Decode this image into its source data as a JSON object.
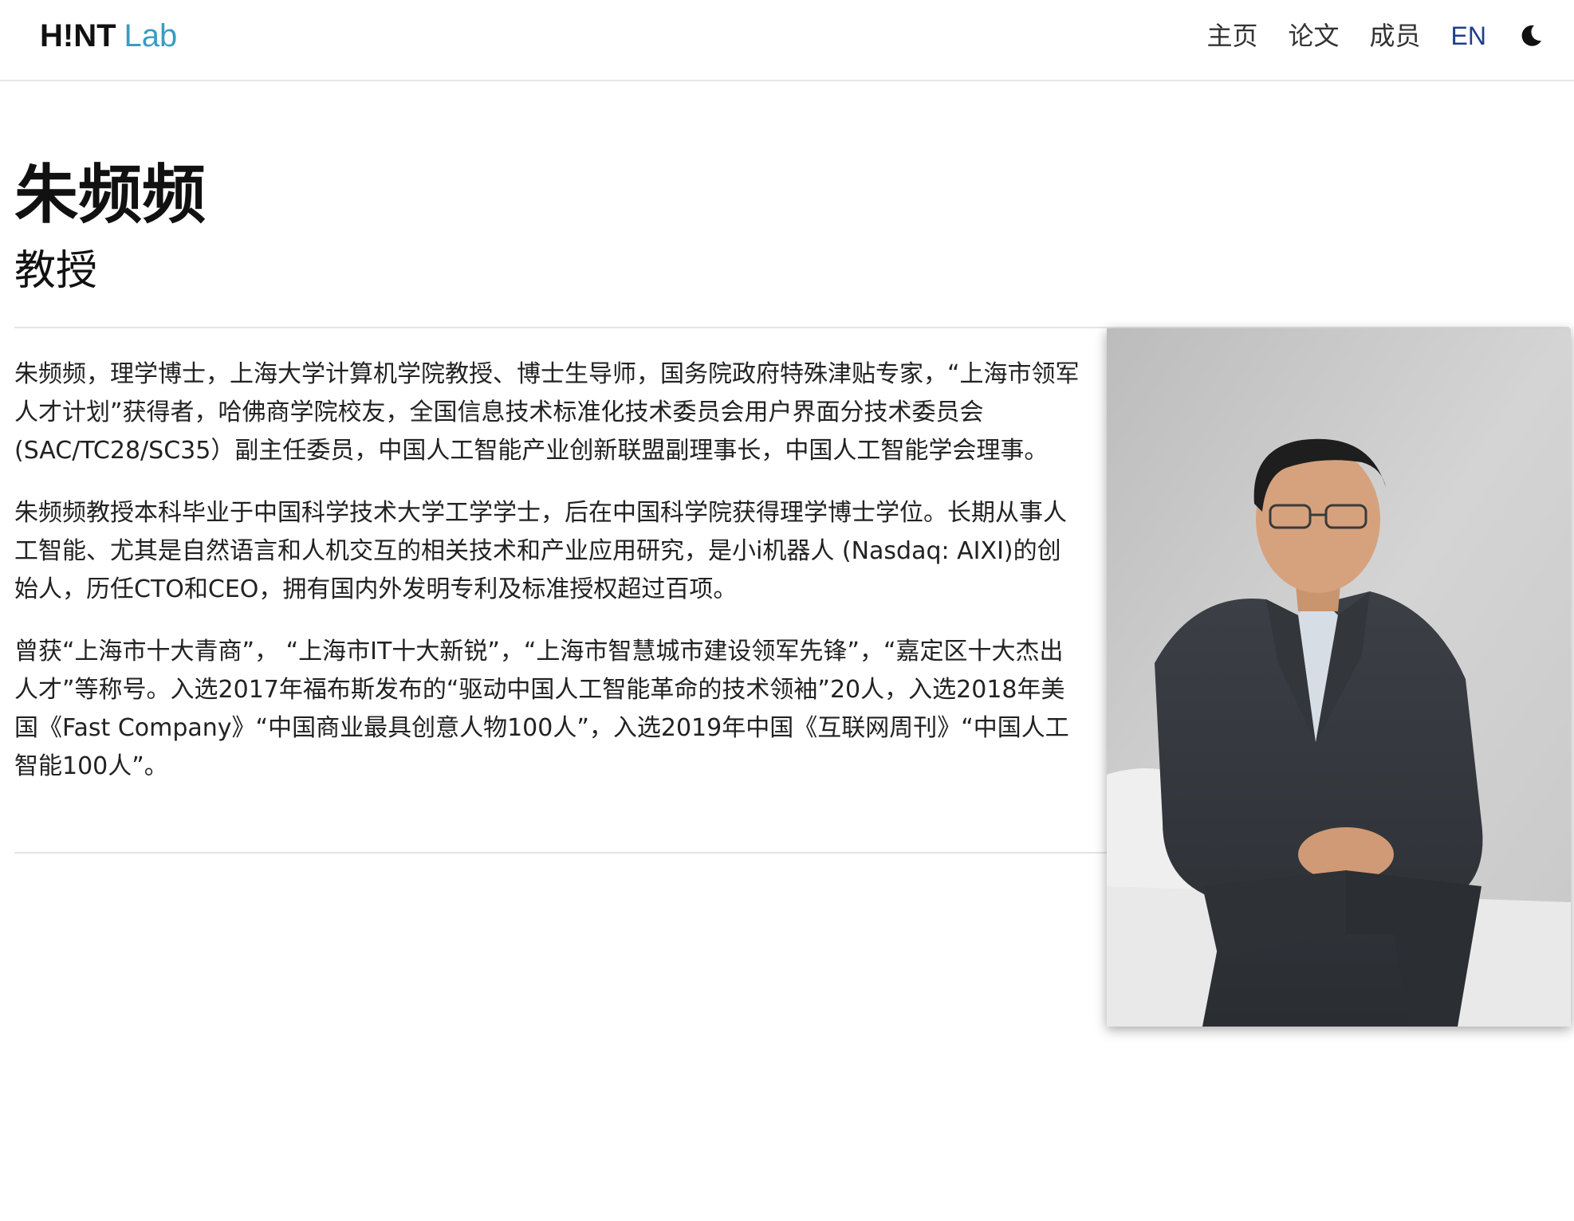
{
  "header": {
    "brand_main": "H!NT",
    "brand_sub": "Lab",
    "nav": [
      "主页",
      "论文",
      "成员"
    ],
    "lang": "EN",
    "theme_icon": "moon-icon"
  },
  "profile": {
    "name": "朱频频",
    "title": "教授",
    "bio": [
      "朱频频，理学博士，上海大学计算机学院教授、博士生导师，国务院政府特殊津贴专家，“上海市领军人才计划”获得者，哈佛商学院校友，全国信息技术标准化技术委员会用户界面分技术委员会 (SAC/TC28/SC35）副主任委员，中国人工智能产业创新联盟副理事长，中国人工智能学会理事。",
      "朱频频教授本科毕业于中国科学技术大学工学学士，后在中国科学院获得理学博士学位。长期从事人工智能、尤其是自然语言和人机交互的相关技术和产业应用研究，是小i机器人 (Nasdaq: AIXI)的创始人，历任CTO和CEO，拥有国内外发明专利及标准授权超过百项。",
      "曾获“上海市十大青商”， “上海市IT十大新锐”，“上海市智慧城市建设领军先锋”，“嘉定区十大杰出人才”等称号。入选2017年福布斯发布的“驱动中国人工智能革命的技术领袖”20人，入选2018年美国《Fast Company》“中国商业最具创意人物100人”，入选2019年中国《互联网周刊》“中国人工智能100人”。"
    ],
    "photo_icon": "portrait-photo"
  }
}
